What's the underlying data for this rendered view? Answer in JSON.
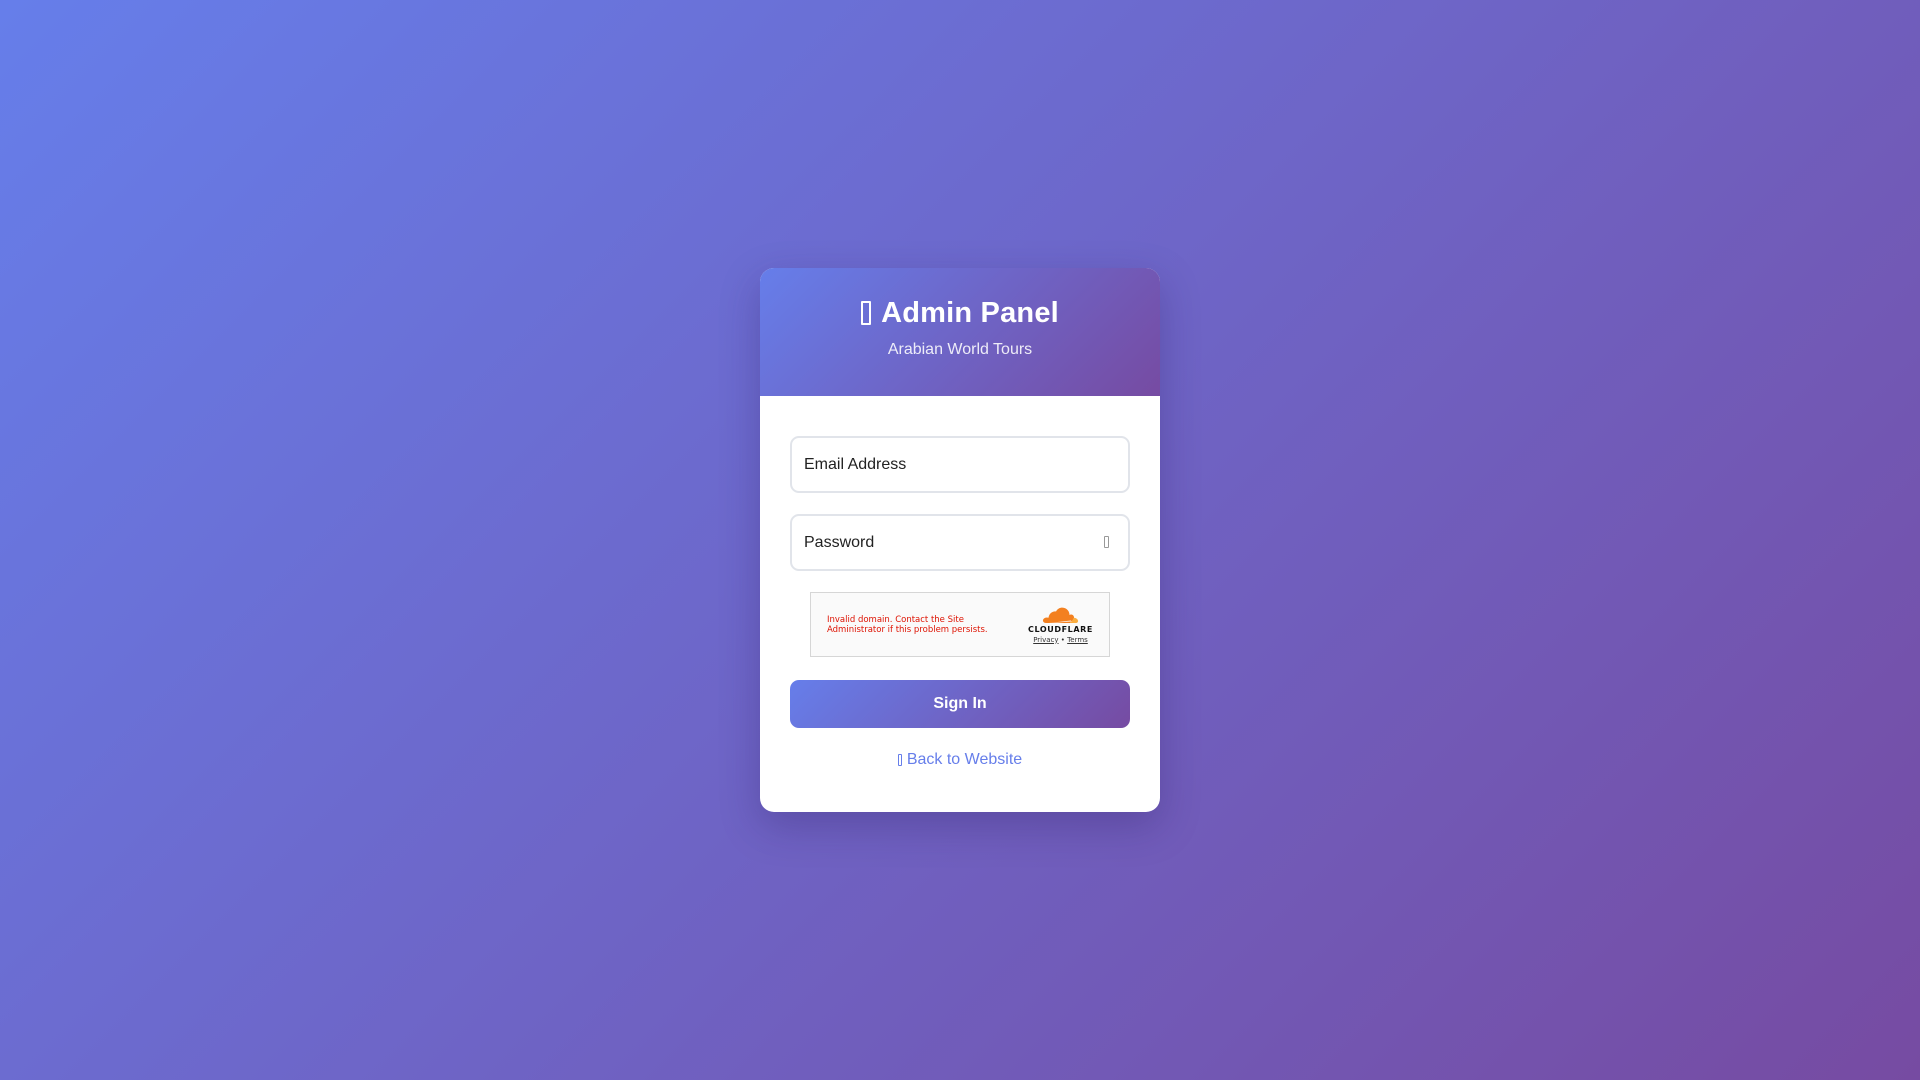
{
  "header": {
    "title": "Admin Panel",
    "title_icon": "lock-icon",
    "subtitle": "Arabian World Tours"
  },
  "form": {
    "email": {
      "placeholder": "Email Address",
      "value": ""
    },
    "password": {
      "placeholder": "Password",
      "value": "",
      "toggle_icon": "eye-icon"
    },
    "submit_label": "Sign In"
  },
  "captcha": {
    "error": "Invalid domain. Contact the Site Administrator if this problem persists.",
    "brand": "CLOUDFLARE",
    "privacy_label": "Privacy",
    "separator": "•",
    "terms_label": "Terms",
    "logo_colors": [
      "#f38020",
      "#faae40"
    ]
  },
  "footer": {
    "back_label": "Back to Website",
    "back_icon": "arrow-left-icon"
  },
  "colors": {
    "gradient_start": "#667eea",
    "gradient_end": "#764ba2",
    "error": "#de1303"
  }
}
